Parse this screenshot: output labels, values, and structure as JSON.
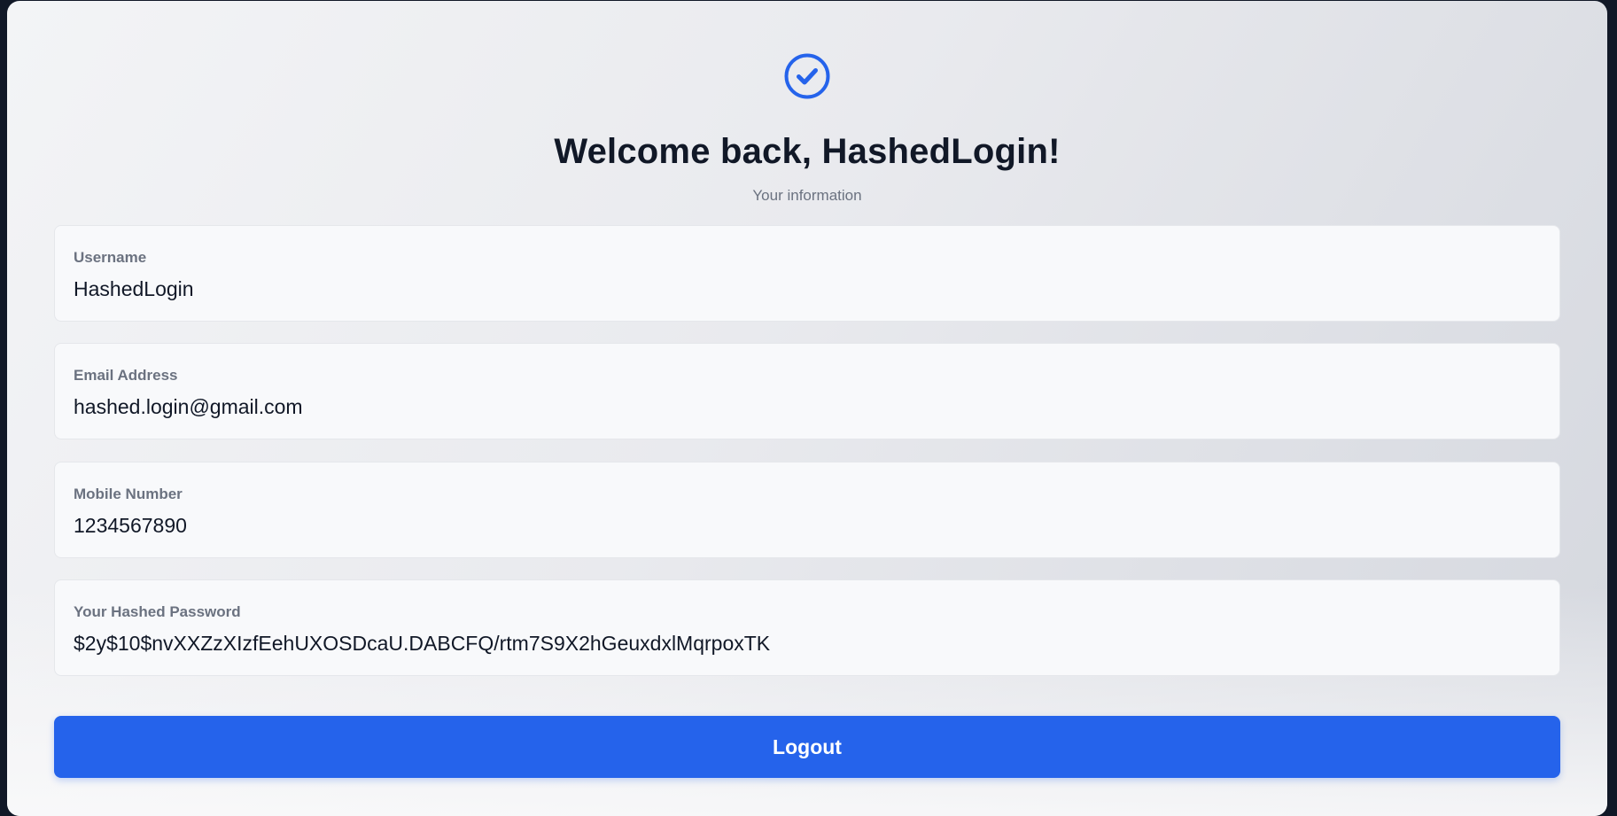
{
  "header": {
    "icon": "check-circle-icon",
    "title": "Welcome back, HashedLogin!",
    "subtitle": "Your information"
  },
  "fields": [
    {
      "label": "Username",
      "value": "HashedLogin"
    },
    {
      "label": "Email Address",
      "value": "hashed.login@gmail.com"
    },
    {
      "label": "Mobile Number",
      "value": "1234567890"
    },
    {
      "label": "Your Hashed Password",
      "value": "$2y$10$nvXXZzXIzfEehUXOSDcaU.DABCFQ/rtm7S9X2hGeuxdxlMqrpoxTK"
    }
  ],
  "actions": {
    "logout_label": "Logout"
  },
  "colors": {
    "accent": "#2563eb",
    "title": "#111827",
    "muted": "#6b7280"
  }
}
